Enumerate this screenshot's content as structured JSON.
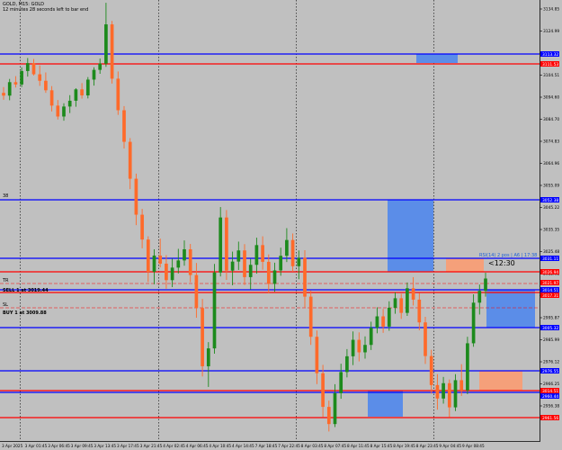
{
  "chart_header": {
    "symbol_title": "GOLD, M15: GOLD",
    "countdown_text": "12 minutes 28 seconds left to bar end"
  },
  "price_scale": {
    "ticks": [
      "3134.85",
      "3124.99",
      "3115.16",
      "3104.51",
      "3094.60",
      "3084.70",
      "3074.83",
      "3064.96",
      "3055.09",
      "3045.22",
      "3035.35",
      "3025.48",
      "3015.61",
      "3005.74",
      "2995.87",
      "2985.99",
      "2976.12",
      "2966.25",
      "2956.38"
    ]
  },
  "time_axis": {
    "labels": [
      "3 Apr 2025",
      "3 Apr 01:45",
      "3 Apr 06:45",
      "3 Apr 09:45",
      "3 Apr 13:45",
      "3 Apr 17:45",
      "3 Apr 21:45",
      "4 Apr 02:45",
      "4 Apr 06:45",
      "4 Apr 10:45",
      "4 Apr 14:45",
      "7 Apr 18:45",
      "7 Apr 22:45",
      "8 Apr 03:45",
      "8 Apr 07:45",
      "8 Apr 11:45",
      "8 Apr 15:45",
      "8 Apr 19:45",
      "8 Apr 23:45",
      "9 Apr 04:45",
      "9 Apr 08:45"
    ]
  },
  "levels": {
    "blue": [
      {
        "price": 3113.32,
        "label": "3113.32"
      },
      {
        "price": 3052.38,
        "label": "3052.38"
      },
      {
        "price": 3031.11,
        "label": "3031.11"
      },
      {
        "price": 3014.51,
        "label": "3014.51"
      },
      {
        "price": 3005.32,
        "label": "3005.32"
      },
      {
        "price": 2976.55,
        "label": "2976.55"
      },
      {
        "price": 2960.44,
        "label": "2960.44"
      }
    ],
    "red": [
      {
        "price": 3111.53,
        "label": "3111.53"
      },
      {
        "price": 3026.94,
        "label": "3026.94"
      },
      {
        "price": 3014.51,
        "label": "3014.51"
      },
      {
        "price": 2961.56,
        "label": "2961.56"
      },
      {
        "price": 2961.54,
        "label": "2961.54"
      }
    ],
    "colors": {
      "blue": "#0000ff",
      "red": "#ff0000"
    }
  },
  "price_tags": {
    "last_price": "3021.97",
    "bid_price": "3017.31",
    "extra": [
      "3018.44",
      "3015.33"
    ]
  },
  "zones": {
    "colors": {
      "blue": "#5b8de8",
      "orange": "#f5a07a"
    }
  },
  "annotations": {
    "side_labels": [
      "38",
      "TR",
      "SL"
    ],
    "sell_order": "SELL 1 at 3019.44",
    "buy_order": "BUY 1 at 3009.88",
    "rsi_text": "RSI(14) 2 pos | A6 | 17:38",
    "timer_text": "<12:30"
  },
  "candles": {
    "colors": {
      "up": "#1c8a1c",
      "down": "#ff6a2a"
    }
  },
  "chart_data": {
    "type": "candlestick",
    "symbol": "GOLD",
    "timeframe": "M15",
    "ylim": [
      2952.0,
      3142.0
    ],
    "ohlc_series": [
      [
        3102.0,
        3104.5,
        3099.0,
        3100.8
      ],
      [
        3100.8,
        3108.0,
        3098.8,
        3106.6
      ],
      [
        3106.6,
        3109.2,
        3104.3,
        3105.6
      ],
      [
        3105.6,
        3113.0,
        3104.5,
        3111.4
      ],
      [
        3111.4,
        3117.0,
        3109.0,
        3114.8
      ],
      [
        3114.8,
        3116.6,
        3109.5,
        3110.0
      ],
      [
        3110.0,
        3113.8,
        3105.0,
        3107.2
      ],
      [
        3107.2,
        3110.8,
        3102.0,
        3103.1
      ],
      [
        3103.1,
        3104.9,
        3094.0,
        3096.5
      ],
      [
        3096.5,
        3098.9,
        3090.5,
        3091.8
      ],
      [
        3091.8,
        3097.5,
        3090.0,
        3096.1
      ],
      [
        3096.1,
        3101.0,
        3093.3,
        3098.6
      ],
      [
        3098.6,
        3104.0,
        3096.0,
        3103.5
      ],
      [
        3103.5,
        3106.2,
        3099.5,
        3100.9
      ],
      [
        3100.9,
        3108.8,
        3099.6,
        3107.7
      ],
      [
        3107.7,
        3113.0,
        3105.1,
        3111.9
      ],
      [
        3111.9,
        3116.8,
        3110.2,
        3114.6
      ],
      [
        3114.6,
        3140.8,
        3113.2,
        3131.5
      ],
      [
        3131.5,
        3133.0,
        3106.0,
        3108.1
      ],
      [
        3108.1,
        3111.2,
        3092.5,
        3094.5
      ],
      [
        3094.5,
        3096.3,
        3078.0,
        3080.9
      ],
      [
        3080.9,
        3082.5,
        3060.5,
        3065.0
      ],
      [
        3065.0,
        3067.2,
        3045.0,
        3049.5
      ],
      [
        3049.5,
        3052.0,
        3035.0,
        3038.8
      ],
      [
        3038.8,
        3040.2,
        3020.5,
        3024.9
      ],
      [
        3024.9,
        3034.6,
        3019.5,
        3031.9
      ],
      [
        3031.9,
        3039.2,
        3026.8,
        3028.4
      ],
      [
        3028.4,
        3032.1,
        3017.6,
        3021.3
      ],
      [
        3021.3,
        3030.6,
        3018.3,
        3026.7
      ],
      [
        3026.7,
        3034.8,
        3024.2,
        3029.8
      ],
      [
        3029.8,
        3038.4,
        3027.5,
        3034.6
      ],
      [
        3034.6,
        3036.9,
        3020.4,
        3023.5
      ],
      [
        3023.5,
        3028.7,
        3005.1,
        3009.3
      ],
      [
        3009.3,
        3013.2,
        2979.8,
        2984.2
      ],
      [
        2984.2,
        2994.6,
        2975.3,
        2991.9
      ],
      [
        2991.9,
        3028.3,
        2989.6,
        3024.6
      ],
      [
        3024.6,
        3052.8,
        3022.9,
        3048.3
      ],
      [
        3048.3,
        3051.5,
        3021.4,
        3025.4
      ],
      [
        3025.4,
        3033.6,
        3019.1,
        3029.3
      ],
      [
        3029.3,
        3037.9,
        3025.7,
        3034.1
      ],
      [
        3034.1,
        3036.8,
        3019.2,
        3022.6
      ],
      [
        3022.6,
        3030.5,
        3017.3,
        3027.9
      ],
      [
        3027.9,
        3039.6,
        3024.1,
        3036.4
      ],
      [
        3036.4,
        3040.2,
        3025.8,
        3029.2
      ],
      [
        3029.2,
        3032.4,
        3015.6,
        3019.7
      ],
      [
        3019.7,
        3028.8,
        3016.3,
        3025.5
      ],
      [
        3025.5,
        3035.3,
        3023.2,
        3031.8
      ],
      [
        3031.8,
        3043.7,
        3029.1,
        3038.6
      ],
      [
        3038.6,
        3041.4,
        3024.9,
        3027.3
      ],
      [
        3027.3,
        3034.1,
        3021.7,
        3030.9
      ],
      [
        3030.9,
        3034.2,
        3009.5,
        3014.2
      ],
      [
        3014.2,
        3016.8,
        2993.4,
        2996.9
      ],
      [
        2996.9,
        2999.6,
        2976.5,
        2981.2
      ],
      [
        2981.2,
        2984.8,
        2962.3,
        2966.7
      ],
      [
        2966.7,
        2969.4,
        2956.1,
        2959.3
      ],
      [
        2959.3,
        2976.5,
        2958.0,
        2972.6
      ],
      [
        2972.6,
        2985.3,
        2970.2,
        2981.7
      ],
      [
        2981.7,
        2991.6,
        2979.4,
        2988.5
      ],
      [
        2988.5,
        2999.2,
        2984.7,
        2995.6
      ],
      [
        2995.6,
        2998.8,
        2986.3,
        2990.2
      ],
      [
        2990.2,
        2997.1,
        2987.5,
        2993.4
      ],
      [
        2993.4,
        3003.4,
        2991.2,
        3000.8
      ],
      [
        3000.8,
        3009.6,
        2998.4,
        3005.7
      ],
      [
        3005.7,
        3008.9,
        2998.6,
        3001.3
      ],
      [
        3001.3,
        3012.2,
        2999.5,
        3009.4
      ],
      [
        3009.4,
        3016.1,
        3006.8,
        3013.5
      ],
      [
        3013.5,
        3015.4,
        3004.6,
        3007.2
      ],
      [
        3007.2,
        3020.3,
        3005.9,
        3017.8
      ],
      [
        3017.8,
        3022.6,
        3010.4,
        3012.9
      ],
      [
        3012.9,
        3015.8,
        2999.7,
        3003.1
      ],
      [
        3003.1,
        3005.5,
        2985.2,
        2988.6
      ],
      [
        2988.6,
        2991.3,
        2972.4,
        2976.1
      ],
      [
        2976.1,
        2980.8,
        2965.5,
        2970.3
      ],
      [
        2970.3,
        2979.6,
        2968.1,
        2976.9
      ],
      [
        2976.9,
        2978.5,
        2962.3,
        2966.5
      ],
      [
        2966.5,
        2980.8,
        2964.9,
        2978.2
      ],
      [
        2978.2,
        2985.1,
        2971.4,
        2973.8
      ],
      [
        2973.8,
        2996.9,
        2972.2,
        2994.1
      ],
      [
        2994.1,
        3015.2,
        2992.6,
        3011.6
      ],
      [
        3011.6,
        3019.4,
        3006.5,
        3016.7
      ],
      [
        3016.7,
        3024.5,
        3014.2,
        3022.0
      ]
    ]
  }
}
